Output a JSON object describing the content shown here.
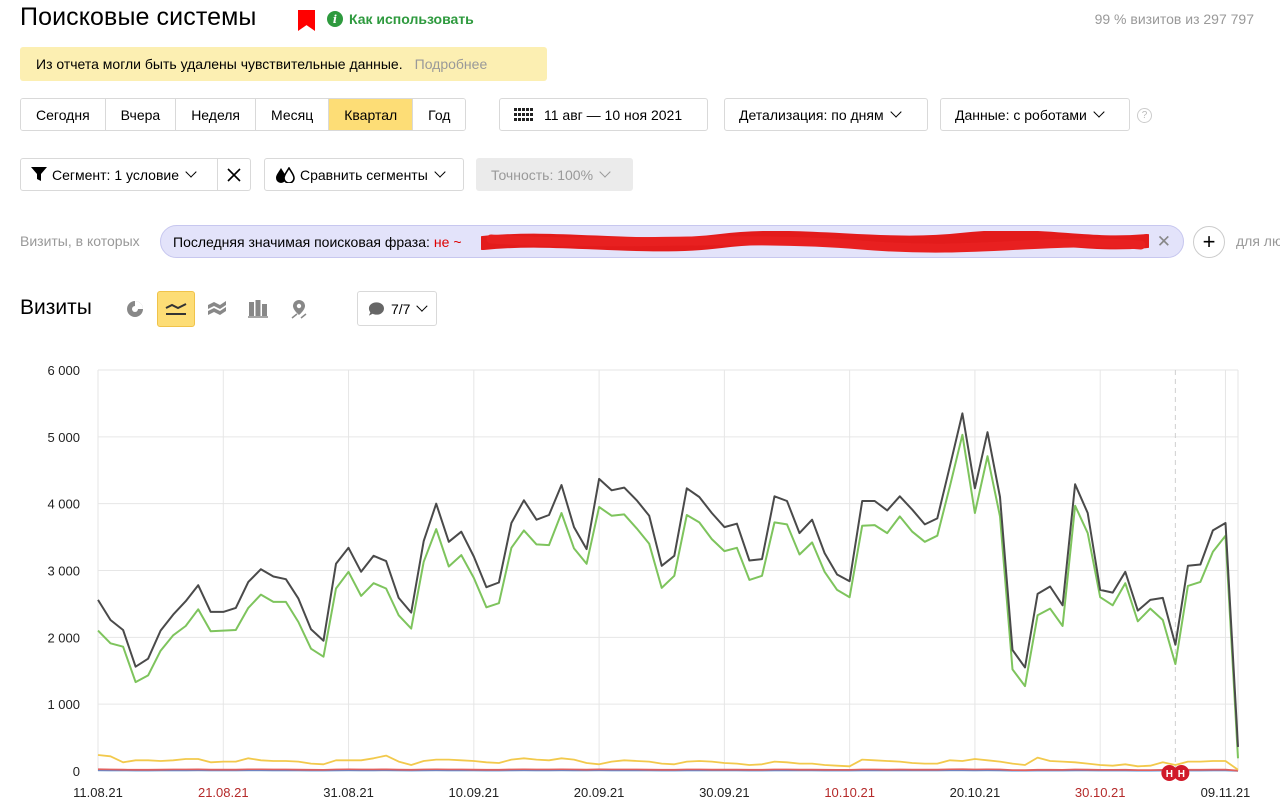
{
  "header": {
    "title": "Поисковые системы",
    "how_to_use": "Как использовать",
    "visits_stat": "99 % визитов из 297 797"
  },
  "notice": {
    "text": "Из отчета могли быть удалены чувствительные данные.",
    "more": "Подробнее"
  },
  "periods": [
    "Сегодня",
    "Вчера",
    "Неделя",
    "Месяц",
    "Квартал",
    "Год"
  ],
  "active_period": "Квартал",
  "date_range": "11 авг — 10 ноя 2021",
  "detail": "Детализация: по дням",
  "data_mode": "Данные: с роботами",
  "segment": "Сегмент: 1 условие",
  "compare": "Сравнить сегменты",
  "accuracy": "Точность: 100%",
  "filter": {
    "prefix": "Визиты, в которых",
    "condition": "Последняя значимая поисковая фраза:",
    "operator": "не ~",
    "after_plus": "для лю"
  },
  "chart_toolbar": {
    "title": "Визиты",
    "comments": "7/7",
    "icons": [
      "pie-chart-icon",
      "line-chart-icon",
      "area-chart-icon",
      "bar-chart-icon",
      "map-icon"
    ]
  },
  "colors": {
    "accent_yellow": "#fddd76",
    "series_total": "#4a4a4a",
    "series_green": "#7ec45d",
    "series_yellow": "#f2c94c",
    "red_label": "#b52a2a",
    "annotation": "#d11a2a"
  },
  "chart_data": {
    "type": "line",
    "title": "",
    "ylim": [
      0,
      6000
    ],
    "y_ticks": [
      "0",
      "1 000",
      "2 000",
      "3 000",
      "4 000",
      "5 000",
      "6 000"
    ],
    "x_ticks": [
      {
        "label": "11.08.21",
        "index": 0,
        "weekend": false
      },
      {
        "label": "21.08.21",
        "index": 10,
        "weekend": true
      },
      {
        "label": "31.08.21",
        "index": 20,
        "weekend": false
      },
      {
        "label": "10.09.21",
        "index": 30,
        "weekend": false
      },
      {
        "label": "20.09.21",
        "index": 40,
        "weekend": false
      },
      {
        "label": "30.09.21",
        "index": 50,
        "weekend": false
      },
      {
        "label": "10.10.21",
        "index": 60,
        "weekend": true
      },
      {
        "label": "20.10.21",
        "index": 70,
        "weekend": false
      },
      {
        "label": "30.10.21",
        "index": 80,
        "weekend": true
      },
      {
        "label": "09.11.21",
        "index": 90,
        "weekend": false
      }
    ],
    "annotation_index": 86,
    "annotation_labels": [
      "Н",
      "Н"
    ],
    "series": [
      {
        "color": "#4a4a4a",
        "values": [
          2560,
          2260,
          2110,
          1560,
          1680,
          2100,
          2340,
          2540,
          2780,
          2380,
          2380,
          2440,
          2830,
          3020,
          2910,
          2870,
          2580,
          2120,
          1950,
          3100,
          3340,
          2980,
          3220,
          3140,
          2590,
          2370,
          3440,
          4000,
          3430,
          3580,
          3210,
          2750,
          2820,
          3710,
          4050,
          3760,
          3830,
          4280,
          3650,
          3320,
          4370,
          4200,
          4240,
          4050,
          3820,
          3070,
          3220,
          4230,
          4100,
          3860,
          3650,
          3700,
          3150,
          3170,
          4110,
          4040,
          3560,
          3760,
          3260,
          2940,
          2840,
          4040,
          4040,
          3900,
          4110,
          3910,
          3690,
          3780,
          4560,
          5350,
          4230,
          5070,
          4100,
          1810,
          1550,
          2650,
          2760,
          2480,
          4290,
          3860,
          2710,
          2670,
          2980,
          2400,
          2560,
          2590,
          1890,
          3070,
          3090,
          3600,
          3710,
          360
        ]
      },
      {
        "color": "#7ec45d",
        "values": [
          2100,
          1910,
          1860,
          1330,
          1430,
          1800,
          2030,
          2170,
          2420,
          2090,
          2100,
          2110,
          2440,
          2640,
          2530,
          2530,
          2230,
          1830,
          1710,
          2730,
          2980,
          2620,
          2810,
          2730,
          2330,
          2130,
          3130,
          3620,
          3060,
          3230,
          2890,
          2450,
          2510,
          3340,
          3600,
          3390,
          3380,
          3860,
          3330,
          3100,
          3950,
          3820,
          3840,
          3630,
          3400,
          2740,
          2920,
          3830,
          3720,
          3470,
          3290,
          3340,
          2860,
          2920,
          3720,
          3690,
          3240,
          3420,
          2980,
          2710,
          2600,
          3670,
          3680,
          3560,
          3810,
          3580,
          3430,
          3520,
          4260,
          5030,
          3860,
          4710,
          3810,
          1520,
          1270,
          2330,
          2430,
          2170,
          3970,
          3560,
          2600,
          2480,
          2810,
          2240,
          2430,
          2260,
          1600,
          2770,
          2830,
          3280,
          3520,
          190
        ]
      },
      {
        "color": "#f2c94c",
        "values": [
          240,
          220,
          130,
          160,
          160,
          150,
          160,
          180,
          180,
          130,
          140,
          140,
          190,
          160,
          150,
          150,
          140,
          110,
          100,
          160,
          160,
          160,
          190,
          230,
          140,
          90,
          150,
          170,
          170,
          160,
          150,
          130,
          120,
          170,
          190,
          170,
          160,
          190,
          170,
          120,
          100,
          140,
          160,
          150,
          140,
          110,
          100,
          140,
          150,
          140,
          120,
          110,
          90,
          100,
          140,
          130,
          110,
          110,
          90,
          80,
          70,
          170,
          160,
          150,
          140,
          120,
          110,
          110,
          160,
          150,
          180,
          160,
          140,
          110,
          90,
          200,
          150,
          140,
          130,
          110,
          90,
          80,
          100,
          70,
          80,
          130,
          90,
          140,
          140,
          150,
          150,
          20
        ]
      },
      {
        "color": "#e06060",
        "values": [
          25,
          22,
          20,
          18,
          18,
          20,
          22,
          22,
          24,
          20,
          20,
          20,
          24,
          24,
          22,
          22,
          20,
          18,
          16,
          22,
          24,
          22,
          22,
          24,
          20,
          18,
          22,
          24,
          22,
          22,
          20,
          18,
          18,
          22,
          24,
          22,
          22,
          24,
          22,
          20,
          24,
          22,
          22,
          22,
          20,
          18,
          18,
          22,
          22,
          20,
          20,
          20,
          18,
          18,
          22,
          22,
          20,
          20,
          18,
          16,
          16,
          22,
          22,
          20,
          22,
          20,
          20,
          20,
          24,
          26,
          22,
          24,
          22,
          14,
          12,
          18,
          18,
          16,
          22,
          20,
          16,
          16,
          18,
          14,
          14,
          16,
          12,
          18,
          18,
          20,
          20,
          4
        ]
      },
      {
        "color": "#4a90e2",
        "values": [
          12,
          10,
          10,
          8,
          8,
          10,
          10,
          10,
          12,
          10,
          10,
          10,
          12,
          12,
          10,
          10,
          10,
          8,
          8,
          10,
          12,
          10,
          10,
          12,
          10,
          8,
          10,
          12,
          10,
          10,
          10,
          8,
          8,
          10,
          12,
          10,
          10,
          12,
          10,
          10,
          12,
          10,
          10,
          10,
          10,
          8,
          8,
          10,
          10,
          10,
          10,
          10,
          8,
          8,
          10,
          10,
          10,
          10,
          8,
          8,
          8,
          10,
          10,
          10,
          10,
          10,
          10,
          10,
          12,
          12,
          10,
          12,
          10,
          6,
          6,
          8,
          8,
          8,
          10,
          10,
          8,
          8,
          8,
          6,
          6,
          8,
          6,
          8,
          8,
          10,
          10,
          2
        ]
      }
    ]
  }
}
